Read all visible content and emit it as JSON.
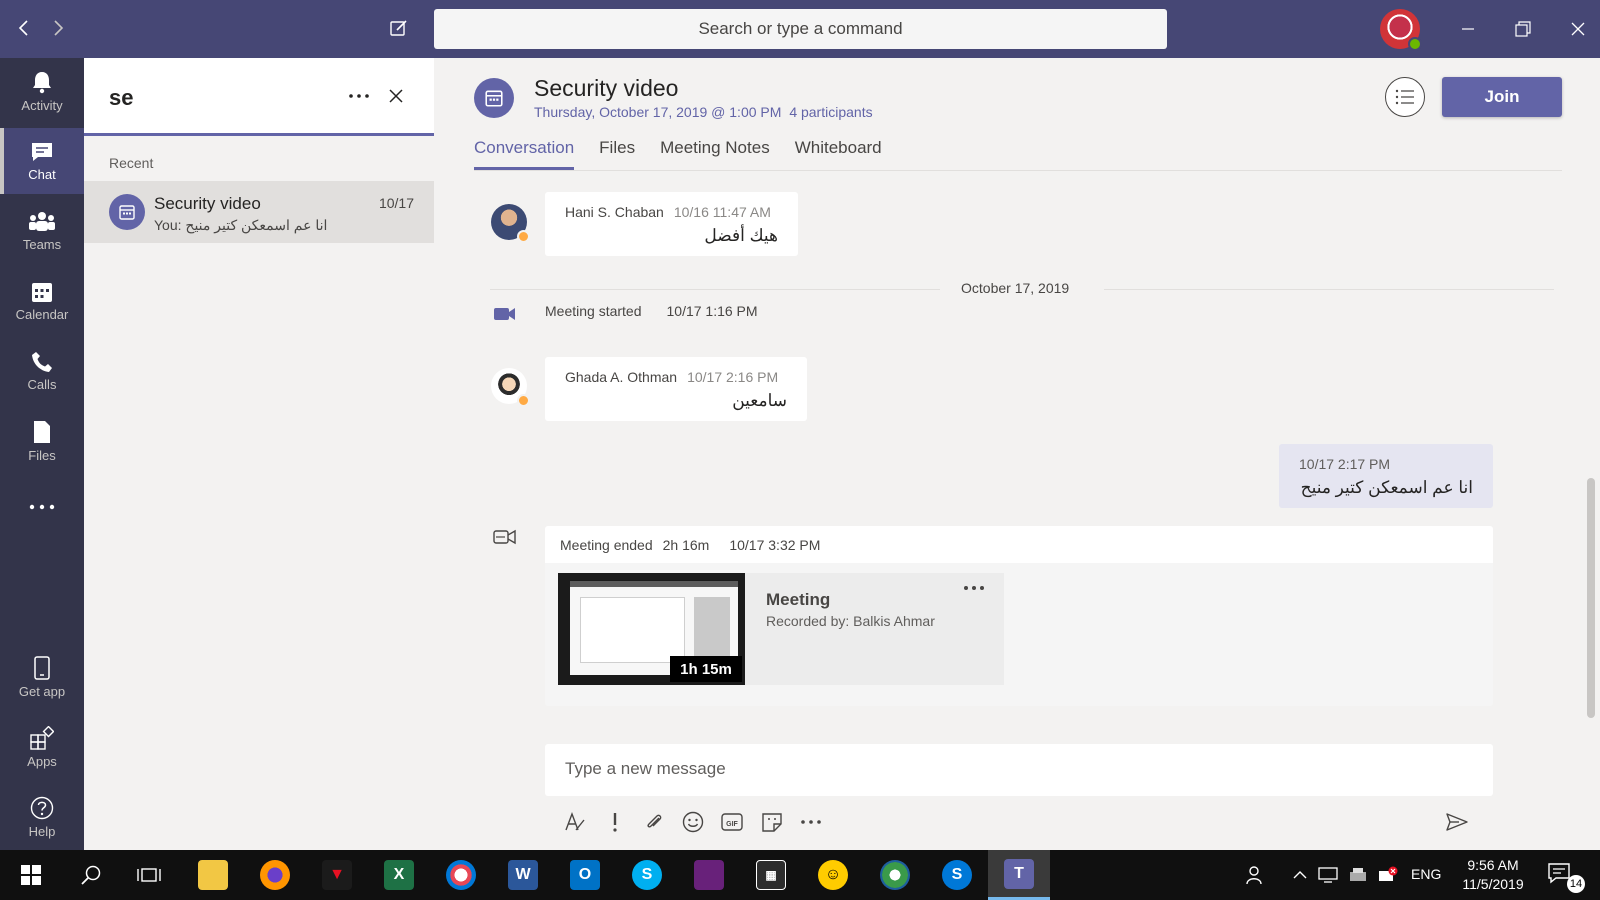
{
  "titlebar": {
    "search_placeholder": "Search or type a command"
  },
  "rail": {
    "items": [
      {
        "label": "Activity",
        "icon": "bell-icon"
      },
      {
        "label": "Chat",
        "icon": "chat-icon"
      },
      {
        "label": "Teams",
        "icon": "teams-icon"
      },
      {
        "label": "Calendar",
        "icon": "calendar-icon"
      },
      {
        "label": "Calls",
        "icon": "phone-icon"
      },
      {
        "label": "Files",
        "icon": "file-icon"
      },
      {
        "label": "",
        "icon": "more-icon"
      },
      {
        "label": "Get app",
        "icon": "mobile-icon"
      },
      {
        "label": "Apps",
        "icon": "apps-icon"
      },
      {
        "label": "Help",
        "icon": "help-icon"
      }
    ]
  },
  "leftpane": {
    "filter_text": "se",
    "recent_label": "Recent",
    "chat_item": {
      "title": "Security video",
      "date": "10/17",
      "preview": "You: انا عم اسمعكن كتير منيح"
    }
  },
  "main": {
    "title": "Security video",
    "subtitle": "Thursday, October 17, 2019 @ 1:00 PM",
    "participants": "4 participants",
    "join_label": "Join",
    "tabs": [
      {
        "label": "Conversation"
      },
      {
        "label": "Files"
      },
      {
        "label": "Meeting Notes"
      },
      {
        "label": "Whiteboard"
      }
    ],
    "messages": [
      {
        "author": "Hani S. Chaban",
        "time": "10/16 11:47 AM",
        "body": "هيك أفضل"
      },
      {
        "author": "Ghada A. Othman",
        "time": "10/17 2:16 PM",
        "body": "سامعين"
      }
    ],
    "date_divider": "October 17, 2019",
    "meeting_started": {
      "label": "Meeting started",
      "time": "10/17 1:16 PM"
    },
    "my_message": {
      "time": "10/17 2:17 PM",
      "body": "انا عم اسمعكن كتير منيح"
    },
    "meeting_ended": {
      "label": "Meeting ended",
      "duration": "2h 16m",
      "time": "10/17 3:32 PM",
      "recording": {
        "title": "Meeting",
        "recorded_by": "Recorded by: Balkis Ahmar",
        "duration": "1h 15m"
      }
    },
    "composer_placeholder": "Type a new message"
  },
  "taskbar": {
    "lang": "ENG",
    "time": "9:56 AM",
    "date": "11/5/2019",
    "notifications": "14",
    "apps": [
      "windows-start",
      "search",
      "task-view",
      "file-explorer",
      "firefox",
      "pdf-reader",
      "excel",
      "paint",
      "word",
      "outlook",
      "skype",
      "visual-studio",
      "calculator",
      "cyberghost",
      "network-app",
      "skype-business",
      "teams"
    ]
  },
  "colors": {
    "titlebar": "#464775",
    "rail": "#33344a",
    "accent": "#6264a7",
    "background": "#f3f2f1"
  }
}
